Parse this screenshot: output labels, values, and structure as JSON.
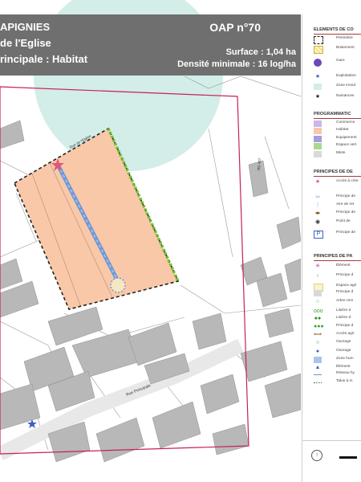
{
  "header": {
    "commune": "APIGNIES",
    "site": "de l'Eglise",
    "vocation": "rincipale : Habitat",
    "oap_number": "OAP n°70",
    "surface": "Surface : 1,04 ha",
    "density": "Densité minimale : 16 log/ha"
  },
  "streets": {
    "rue_eglise": "Rue de l'Eglise",
    "rd": "RD 427",
    "rue_principale": "Rue Principale"
  },
  "legend": {
    "sections": [
      {
        "title": "ELEMENTS DE CO",
        "items": [
          {
            "label": "Périmètre",
            "icon": "dashed-rect-icon"
          },
          {
            "label": "Boisement",
            "icon": "yellow-hatch-icon"
          },
          {
            "label": "Gare",
            "icon": "train-circle-icon"
          },
          {
            "label": "Exploitation",
            "icon": "blue-star-icon"
          },
          {
            "label": "Zone inond",
            "icon": "circle-dashed-icon"
          },
          {
            "label": "Nuisances",
            "icon": "small-star-icon"
          }
        ]
      },
      {
        "title": "PROGRAMMATIC",
        "items": [
          {
            "label": "Commerce",
            "icon": "purple-swatch-icon"
          },
          {
            "label": "Habitat",
            "icon": "orange-swatch-icon"
          },
          {
            "label": "Equipement",
            "icon": "violet-swatch-icon"
          },
          {
            "label": "Espace vert",
            "icon": "green-swatch-icon"
          },
          {
            "label": "Mixte",
            "icon": "grey-swatch-icon"
          }
        ]
      },
      {
        "title": "PRINCIPES DE DE",
        "items": [
          {
            "label": "Accès à crée",
            "icon": "pink-star-icon"
          },
          {
            "label": "Principe de",
            "icon": "blue-arrow-icon"
          },
          {
            "label": "Aire de ret",
            "icon": "blue-dots-icon"
          },
          {
            "label": "Principe de",
            "icon": "brown-arrow-icon"
          },
          {
            "label": "Point de",
            "icon": "dot-circle-icon"
          },
          {
            "label": "Principe de",
            "icon": "parking-icon"
          }
        ]
      },
      {
        "title": "PRINCIPES DE PA",
        "items": [
          {
            "label": "Élément",
            "icon": "purple-asterisk-icon"
          },
          {
            "label": "Principe d",
            "icon": "green-chevron-icon"
          },
          {
            "label": "Espace agri",
            "icon": "pale-yellow-swatch-icon"
          },
          {
            "label": "Principe d",
            "icon": "grey-swatch-icon"
          },
          {
            "label": "Arbre rem",
            "icon": "green-ring-icon"
          },
          {
            "label": "Lisière d",
            "icon": "green-ring-row-icon"
          },
          {
            "label": "Lisière d",
            "icon": "green-bold-ring-row-icon"
          },
          {
            "label": "Principe d",
            "icon": "green-dots-icon"
          },
          {
            "label": "Accès agri",
            "icon": "double-arrow-icon"
          },
          {
            "label": "Ouvrage",
            "icon": "blue-ring-icon"
          },
          {
            "label": "Ouvrage",
            "icon": "blue-filled-ring-icon"
          },
          {
            "label": "Zone hum",
            "icon": "blue-swatch-icon"
          },
          {
            "label": "Élément",
            "icon": "blue-triangle-icon"
          },
          {
            "label": "Réseau hy",
            "icon": "blue-line-icon"
          },
          {
            "label": "Talus à m",
            "icon": "dotted-line-icon"
          }
        ]
      }
    ]
  },
  "colors": {
    "habitat": "#f9c8a8",
    "perimeter": "#c8205a",
    "green_edge": "#6fbf2e",
    "buildings": "#b8b8b8",
    "header_bg": "#6f6f6f",
    "flood_zone": "#d3ede8"
  }
}
